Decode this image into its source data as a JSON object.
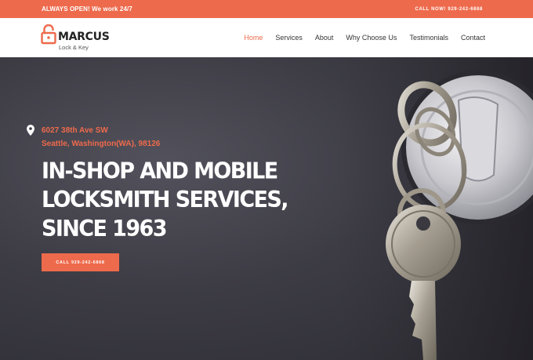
{
  "topbar": {
    "left_text": "ALWAYS OPEN! We work 24/7",
    "right_text": "CALL NOW! 929-242-6868"
  },
  "logo": {
    "name": "MARCUS",
    "subtitle": "Lock & Key",
    "icon": "padlock-icon"
  },
  "nav": {
    "items": [
      {
        "label": "Home",
        "active": true
      },
      {
        "label": "Services"
      },
      {
        "label": "About"
      },
      {
        "label": "Why Choose Us"
      },
      {
        "label": "Testimonials"
      },
      {
        "label": "Contact"
      }
    ]
  },
  "hero": {
    "address_icon": "location-pin-icon",
    "address_line1": "6027 38th Ave SW",
    "address_line2": "Seattle, Washington(WA), 98126",
    "headline_line1": "IN-SHOP AND MOBILE",
    "headline_line2": "LOCKSMITH SERVICES,",
    "headline_line3": "SINCE 1963",
    "cta_label": "CALL 929-242-6868",
    "image": "key-in-lock-image"
  },
  "colors": {
    "accent": "#ee6a4c",
    "hero_background": "#3d3c45",
    "text_dark": "#222222"
  }
}
